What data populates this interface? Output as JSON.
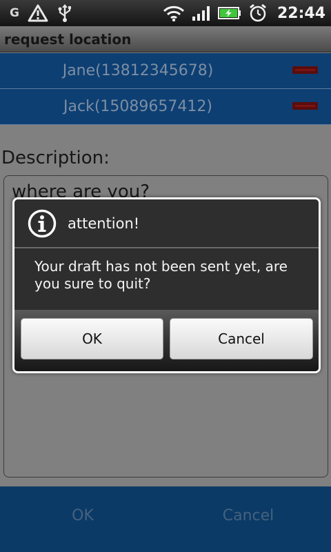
{
  "status_bar": {
    "network_letter": "G",
    "icons": [
      "warning-icon",
      "usb-icon",
      "wifi-icon",
      "signal-icon",
      "battery-charging-icon",
      "alarm-clock-icon"
    ],
    "time": "22:44"
  },
  "title_bar": {
    "title": "request location"
  },
  "recipients": [
    {
      "name": "Jane(13812345678)"
    },
    {
      "name": "Jack(15089657412)"
    }
  ],
  "description": {
    "label": "Description:",
    "text": "where are you?"
  },
  "bottom_bar": {
    "ok_label": "OK",
    "cancel_label": "Cancel"
  },
  "dialog": {
    "title": "attention!",
    "message": "Your draft has not been sent yet, are you sure to quit?",
    "ok_label": "OK",
    "cancel_label": "Cancel"
  },
  "colors": {
    "list_item_bg": "#0d3f73",
    "bottom_bar_bg": "#0c3a66",
    "remove_marker": "#5b0d0d",
    "dialog_bg": "#2e2e2e"
  }
}
